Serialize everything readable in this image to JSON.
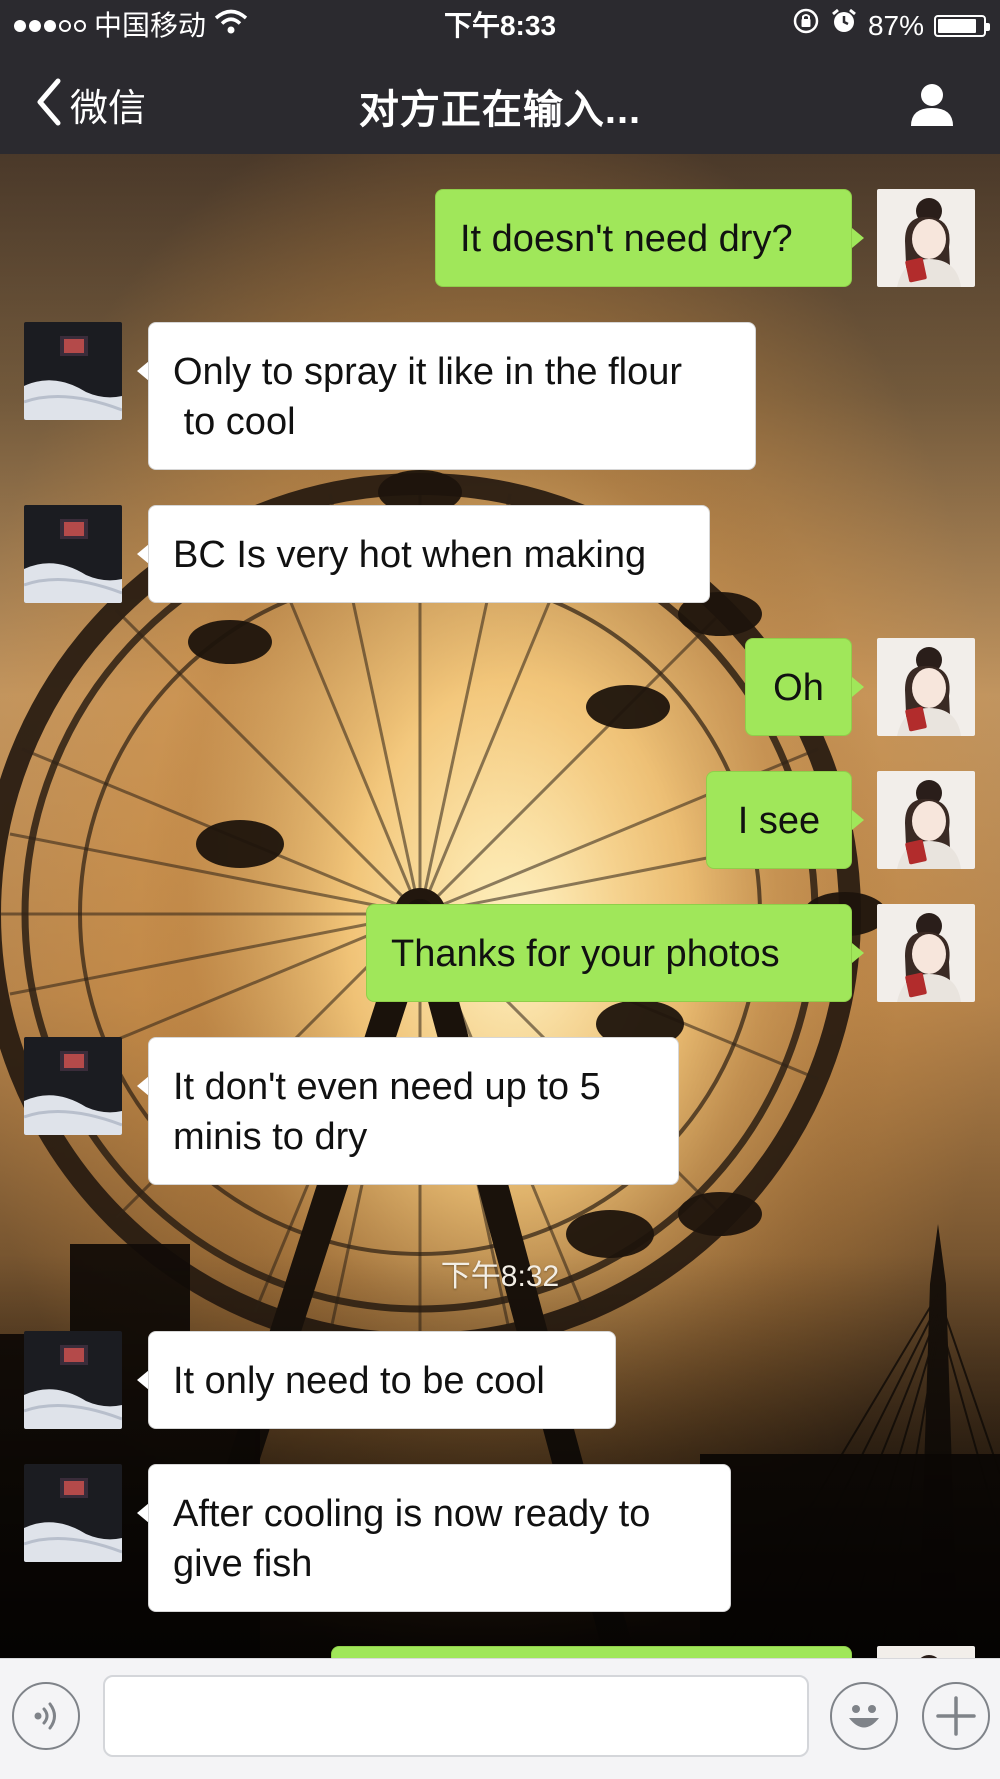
{
  "status_bar": {
    "carrier": "中国移动",
    "time": "下午8:33",
    "battery_text": "87%",
    "battery_level": 0.87
  },
  "nav": {
    "back_label": "微信",
    "title": "对方正在输入..."
  },
  "messages": [
    {
      "side": "outgoing",
      "text": "It doesn't need dry?"
    },
    {
      "side": "incoming",
      "text": "Only to spray it like in the flour\n to cool"
    },
    {
      "side": "incoming",
      "text": "BC Is very hot when making"
    },
    {
      "side": "outgoing",
      "text": "Oh"
    },
    {
      "side": "outgoing",
      "text": "I see"
    },
    {
      "side": "outgoing",
      "text": "Thanks for your photos"
    },
    {
      "side": "incoming",
      "text": "It don't even need up to 5\nminis to dry"
    },
    {
      "side": "incoming",
      "text": "It only need to be cool"
    },
    {
      "side": "incoming",
      "text": "After cooling is now ready to\ngive fish"
    },
    {
      "side": "outgoing",
      "text": ""
    }
  ],
  "timestamp_divider": "下午8:32",
  "input": {
    "value": "",
    "placeholder": ""
  },
  "colors": {
    "outgoing_bubble": "#a0e75a",
    "incoming_bubble": "#ffffff",
    "nav_background": "#2b2a2f",
    "input_bar_background": "#f4f4f6"
  },
  "icons": {
    "back": "chevron-left-icon",
    "profile": "user-icon",
    "wifi": "wifi-icon",
    "lock": "orientation-lock-icon",
    "alarm": "alarm-icon",
    "battery": "battery-icon",
    "voice": "voice-icon",
    "emoji": "emoji-icon",
    "plus": "plus-icon"
  }
}
